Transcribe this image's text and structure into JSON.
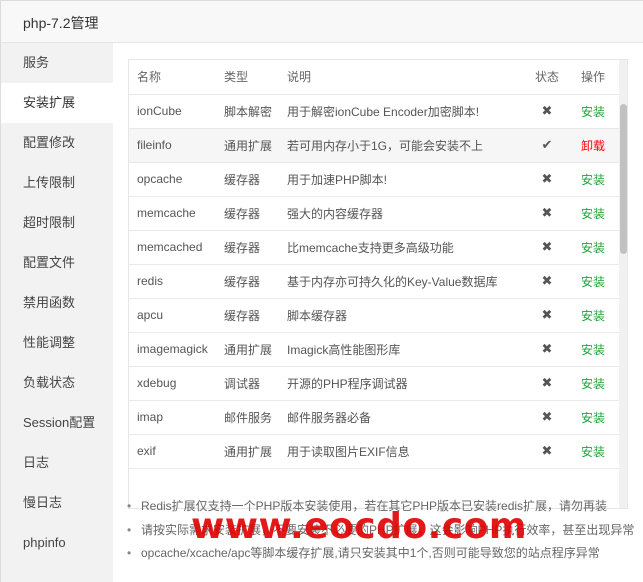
{
  "window": {
    "title": "php-7.2管理"
  },
  "sidebar": {
    "items": [
      {
        "label": "服务"
      },
      {
        "label": "安装扩展"
      },
      {
        "label": "配置修改"
      },
      {
        "label": "上传限制"
      },
      {
        "label": "超时限制"
      },
      {
        "label": "配置文件"
      },
      {
        "label": "禁用函数"
      },
      {
        "label": "性能调整"
      },
      {
        "label": "负载状态"
      },
      {
        "label": "Session配置"
      },
      {
        "label": "日志"
      },
      {
        "label": "慢日志"
      },
      {
        "label": "phpinfo"
      }
    ],
    "active_index": 1
  },
  "table": {
    "headers": {
      "name": "名称",
      "type": "类型",
      "desc": "说明",
      "status": "状态",
      "action": "操作"
    },
    "rows": [
      {
        "name": "ionCube",
        "type": "脚本解密",
        "desc": "用于解密ionCube Encoder加密脚本!",
        "status": "✖",
        "action": "安装",
        "installed": false
      },
      {
        "name": "fileinfo",
        "type": "通用扩展",
        "desc": "若可用内存小于1G，可能会安装不上",
        "status": "✔",
        "action": "卸载",
        "installed": true
      },
      {
        "name": "opcache",
        "type": "缓存器",
        "desc": "用于加速PHP脚本!",
        "status": "✖",
        "action": "安装",
        "installed": false
      },
      {
        "name": "memcache",
        "type": "缓存器",
        "desc": "强大的内容缓存器",
        "status": "✖",
        "action": "安装",
        "installed": false
      },
      {
        "name": "memcached",
        "type": "缓存器",
        "desc": "比memcache支持更多高级功能",
        "status": "✖",
        "action": "安装",
        "installed": false
      },
      {
        "name": "redis",
        "type": "缓存器",
        "desc": "基于内存亦可持久化的Key-Value数据库",
        "status": "✖",
        "action": "安装",
        "installed": false
      },
      {
        "name": "apcu",
        "type": "缓存器",
        "desc": "脚本缓存器",
        "status": "✖",
        "action": "安装",
        "installed": false
      },
      {
        "name": "imagemagick",
        "type": "通用扩展",
        "desc": "Imagick高性能图形库",
        "status": "✖",
        "action": "安装",
        "installed": false
      },
      {
        "name": "xdebug",
        "type": "调试器",
        "desc": "开源的PHP程序调试器",
        "status": "✖",
        "action": "安装",
        "installed": false
      },
      {
        "name": "imap",
        "type": "邮件服务",
        "desc": "邮件服务器必备",
        "status": "✖",
        "action": "安装",
        "installed": false
      },
      {
        "name": "exif",
        "type": "通用扩展",
        "desc": "用于读取图片EXIF信息",
        "status": "✖",
        "action": "安装",
        "installed": false
      }
    ],
    "scrollbar_position": 0.1
  },
  "notes": [
    "Redis扩展仅支持一个PHP版本安装使用，若在其它PHP版本已安装redis扩展，请勿再装",
    "请按实际需求安装扩展，不要安装不必要的PHP扩展，这会影响PHP执行效率，甚至出现异常",
    "opcache/xcache/apc等脚本缓存扩展,请只安装其中1个,否则可能导致您的站点程序异常"
  ],
  "watermark": "www.eocdo.com",
  "colors": {
    "install": "#20a53a",
    "uninstall": "#ff0000",
    "watermark": "#e00000"
  }
}
